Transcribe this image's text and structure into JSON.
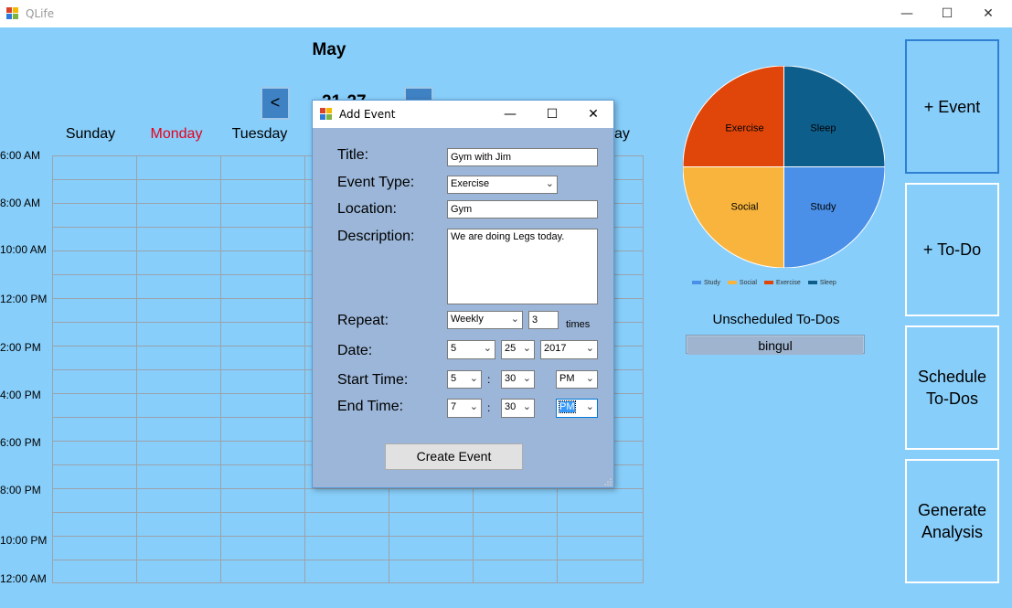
{
  "window": {
    "title": "QLife",
    "minimize": "—",
    "maximize": "☐",
    "close": "✕"
  },
  "calendar": {
    "month": "May",
    "prev_label": "<",
    "days": [
      "Sunday",
      "Monday",
      "Tuesday",
      "ay"
    ],
    "today_color": "#E8001C",
    "times": [
      "6:00 AM",
      "8:00 AM",
      "10:00 AM",
      "12:00 PM",
      "2:00 PM",
      "4:00 PM",
      "6:00 PM",
      "8:00 PM",
      "10:00 PM",
      "12:00 AM"
    ],
    "week_partial": "21-27"
  },
  "chart_data": {
    "type": "pie",
    "slices": [
      {
        "label": "Study",
        "value": 25,
        "color": "#4A90E8"
      },
      {
        "label": "Social",
        "value": 25,
        "color": "#F8B43C"
      },
      {
        "label": "Exercise",
        "value": 25,
        "color": "#E0460A"
      },
      {
        "label": "Sleep",
        "value": 25,
        "color": "#0E5E8C"
      }
    ],
    "legend_position": "bottom"
  },
  "unscheduled": {
    "title": "Unscheduled To-Dos",
    "items": [
      "bingul"
    ]
  },
  "side_buttons": {
    "event": "+ Event",
    "todo": "+ To-Do",
    "schedule_line1": "Schedule",
    "schedule_line2": "To-Dos",
    "analysis_line1": "Generate",
    "analysis_line2": "Analysis"
  },
  "dialog": {
    "title": "Add Event",
    "minimize": "—",
    "maximize": "☐",
    "close": "✕",
    "labels": {
      "title": "Title:",
      "event_type": "Event Type:",
      "location": "Location:",
      "description": "Description:",
      "repeat": "Repeat:",
      "date": "Date:",
      "start_time": "Start Time:",
      "end_time": "End Time:"
    },
    "values": {
      "title": "Gym with Jim",
      "event_type": "Exercise",
      "location": "Gym",
      "description": "We are doing Legs today.",
      "repeat": "Weekly",
      "repeat_count": "3",
      "repeat_suffix": "times",
      "date_month": "5",
      "date_day": "25",
      "date_year": "2017",
      "start_hour": "5",
      "start_minute": "30",
      "start_ampm": "PM",
      "end_hour": "7",
      "end_minute": "30",
      "end_ampm": "PM"
    },
    "colon": ":",
    "create_button": "Create Event"
  }
}
